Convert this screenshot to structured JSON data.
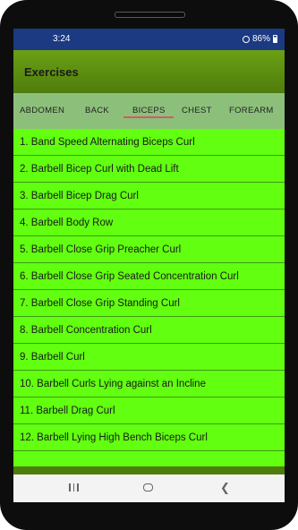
{
  "status_bar": {
    "time": "3:24",
    "battery": "86%"
  },
  "app_bar": {
    "title": "Exercises"
  },
  "tabs": [
    {
      "label": "ABDOMEN"
    },
    {
      "label": "BACK"
    },
    {
      "label": "BICEPS"
    },
    {
      "label": "CHEST"
    },
    {
      "label": "FOREARM"
    }
  ],
  "selected_tab": "BICEPS",
  "exercises": [
    "1. Band Speed Alternating Biceps Curl",
    "2. Barbell Bicep Curl with Dead Lift",
    "3. Barbell Bicep Drag Curl",
    "4. Barbell Body Row",
    "5. Barbell Close Grip Preacher Curl",
    "6. Barbell Close Grip Seated Concentration Curl",
    "7. Barbell Close Grip Standing Curl",
    "8. Barbell Concentration Curl",
    "9. Barbell Curl",
    "10. Barbell Curls Lying against an Incline",
    "11. Barbell Drag Curl",
    "12. Barbell Lying High Bench Biceps Curl"
  ],
  "colors": {
    "status_bar": "#1b3a82",
    "app_bar": "#5a8c10",
    "tabs_background": "#8cc07a",
    "tab_indicator": "#d9566d",
    "list_background": "#62ff10"
  }
}
